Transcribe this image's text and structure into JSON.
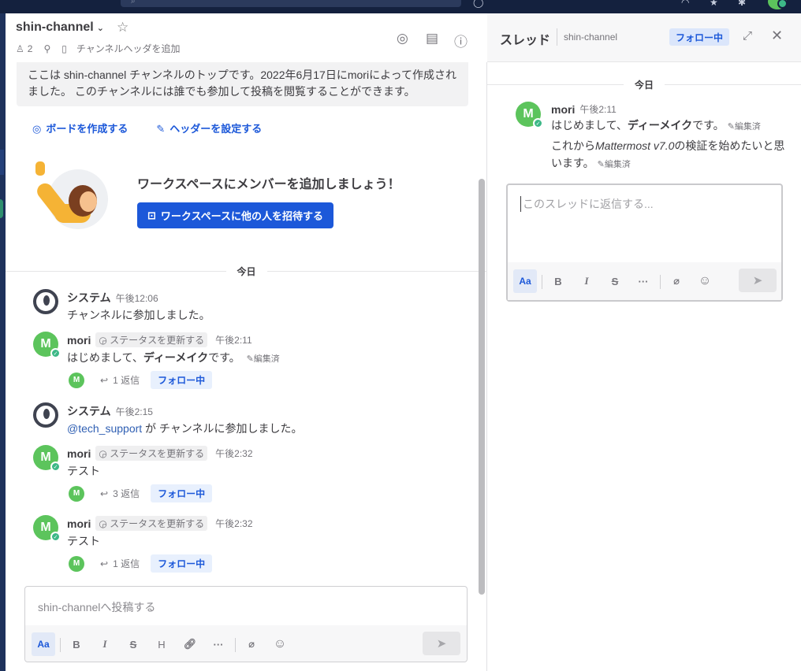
{
  "channel": {
    "name": "shin-channel",
    "member_count": "2",
    "header_placeholder": "チャンネルヘッダを追加"
  },
  "intro": {
    "text": "ここは shin-channel チャンネルのトップです。2022年6月17日にmoriによって作成されました。 このチャンネルには誰でも参加して投稿を閲覧することができます。",
    "create_board": "ボードを作成する",
    "set_header": "ヘッダーを設定する",
    "invite_title": "ワークスペースにメンバーを追加しましょう！",
    "invite_button": "ワークスペースに他の人を招待する"
  },
  "date_separator": "今日",
  "posts": [
    {
      "user": "システム",
      "time": "午後12:06",
      "message": "チャンネルに参加しました。"
    },
    {
      "user": "mori",
      "status_button": "ステータスを更新する",
      "time": "午後2:11",
      "message_prefix": "はじめまして、",
      "message_bold": "ディーメイク",
      "message_suffix": "です。",
      "edited": "編集済",
      "reply_count": "1 返信",
      "follow": "フォロー中",
      "avatar_letter": "M"
    },
    {
      "user": "システム",
      "time": "午後2:15",
      "mention": "@tech_support",
      "message": " が チャンネルに参加しました。"
    },
    {
      "user": "mori",
      "status_button": "ステータスを更新する",
      "time": "午後2:32",
      "message": "テスト",
      "reply_count": "3 返信",
      "follow": "フォロー中",
      "avatar_letter": "M"
    },
    {
      "user": "mori",
      "status_button": "ステータスを更新する",
      "time": "午後2:32",
      "message": "テスト",
      "reply_count": "1 返信",
      "follow": "フォロー中",
      "avatar_letter": "M"
    }
  ],
  "composer": {
    "placeholder": "shin-channelへ投稿する",
    "aa": "Aa"
  },
  "rhs": {
    "title": "スレッド",
    "channel": "shin-channel",
    "follow": "フォロー中",
    "date_separator": "今日",
    "post": {
      "user": "mori",
      "time": "午後2:11",
      "line1_prefix": "はじめまして、",
      "line1_bold": "ディーメイク",
      "line1_suffix": "です。",
      "edited": "編集済",
      "line2_prefix": "これから",
      "line2_italic": "Mattermost v7.0",
      "line2_suffix": "の検証を始めたいと思います。",
      "avatar_letter": "M"
    },
    "reply_placeholder": "このスレッドに返信する...",
    "aa": "Aa"
  },
  "colors": {
    "accent": "#1c58d9",
    "online": "#3db887",
    "avatar": "#5cc45c"
  }
}
